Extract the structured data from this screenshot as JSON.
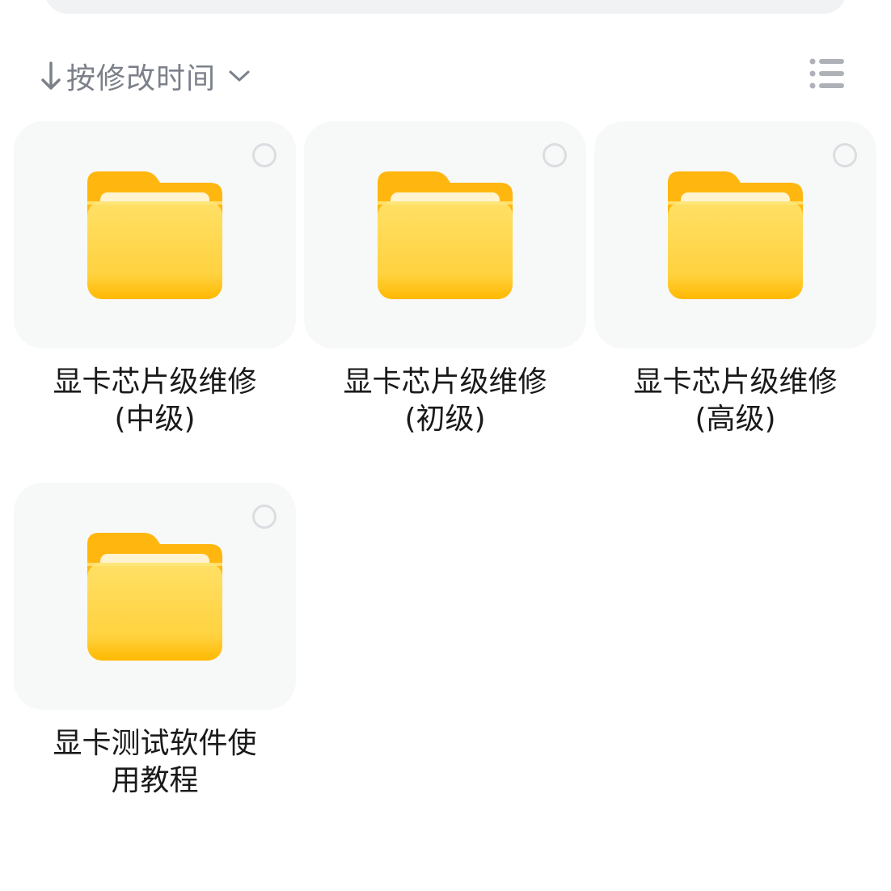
{
  "sort": {
    "label": "按修改时间",
    "direction_icon": "arrow-down-icon",
    "dropdown_icon": "chevron-down-icon"
  },
  "view_toggle": {
    "icon": "list-view-icon"
  },
  "folders": [
    {
      "name_line1": "显卡芯片级维修",
      "name_line2": "(中级)"
    },
    {
      "name_line1": "显卡芯片级维修",
      "name_line2": "(初级)"
    },
    {
      "name_line1": "显卡芯片级维修",
      "name_line2": "(高级)"
    },
    {
      "name_line1": "显卡测试软件使",
      "name_line2": "用教程"
    }
  ],
  "colors": {
    "folder_yellow": "#ffd447",
    "folder_back": "#ffb70f",
    "text_primary": "#1a1a1a",
    "text_secondary": "#7b8089",
    "tile_bg": "#f7f8f8",
    "search_bg": "#f1f2f4"
  }
}
